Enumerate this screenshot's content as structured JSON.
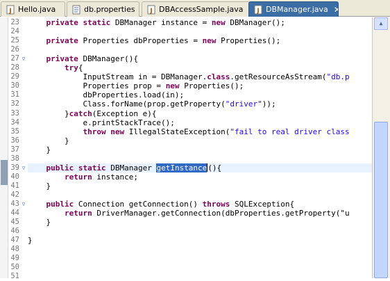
{
  "tabs": [
    {
      "label": "Hello.java",
      "icon": "java-file-icon",
      "active": false
    },
    {
      "label": "db.properties",
      "icon": "properties-file-icon",
      "active": false
    },
    {
      "label": "DBAccessSample.java",
      "icon": "java-file-icon",
      "active": false
    },
    {
      "label": "DBManager.java",
      "icon": "java-file-icon",
      "active": true
    }
  ],
  "close_glyph": "✕",
  "fold_glyph": "▽",
  "colors": {
    "keyword": "#7f0055",
    "string": "#2a00ff",
    "selection": "#316ac5",
    "active_tab": "#3a6ea5"
  },
  "code_lines": [
    {
      "num": "23",
      "fold": false,
      "segs": [
        [
          "kw",
          "    private static "
        ],
        [
          "p",
          "DBManager instance = "
        ],
        [
          "kw",
          "new "
        ],
        [
          "p",
          "DBManager();"
        ]
      ]
    },
    {
      "num": "24",
      "fold": false,
      "segs": []
    },
    {
      "num": "25",
      "fold": false,
      "segs": [
        [
          "kw",
          "    private "
        ],
        [
          "p",
          "Properties dbProperties = "
        ],
        [
          "kw",
          "new "
        ],
        [
          "p",
          "Properties();"
        ]
      ]
    },
    {
      "num": "26",
      "fold": false,
      "segs": []
    },
    {
      "num": "27",
      "fold": true,
      "segs": [
        [
          "kw",
          "    private "
        ],
        [
          "p",
          "DBManager(){"
        ]
      ]
    },
    {
      "num": "28",
      "fold": false,
      "segs": [
        [
          "kw",
          "        try"
        ],
        [
          "p",
          "{"
        ]
      ]
    },
    {
      "num": "29",
      "fold": false,
      "segs": [
        [
          "p",
          "            InputStream in = DBManager."
        ],
        [
          "kw",
          "class"
        ],
        [
          "p",
          ".getResourceAsStream("
        ],
        [
          "str",
          "\"db.p"
        ]
      ]
    },
    {
      "num": "30",
      "fold": false,
      "segs": [
        [
          "p",
          "            Properties prop = "
        ],
        [
          "kw",
          "new "
        ],
        [
          "p",
          "Properties();"
        ]
      ]
    },
    {
      "num": "31",
      "fold": false,
      "segs": [
        [
          "p",
          "            dbProperties.load(in);"
        ]
      ]
    },
    {
      "num": "32",
      "fold": false,
      "segs": [
        [
          "p",
          "            Class.forName(prop.getProperty("
        ],
        [
          "str",
          "\"driver\""
        ],
        [
          "p",
          "));"
        ]
      ]
    },
    {
      "num": "33",
      "fold": false,
      "segs": [
        [
          "p",
          "        }"
        ],
        [
          "kw",
          "catch"
        ],
        [
          "p",
          "(Exception e){"
        ]
      ]
    },
    {
      "num": "34",
      "fold": false,
      "segs": [
        [
          "p",
          "            e.printStackTrace();"
        ]
      ]
    },
    {
      "num": "35",
      "fold": false,
      "segs": [
        [
          "kw",
          "            throw new "
        ],
        [
          "p",
          "IllegalStateException("
        ],
        [
          "str",
          "\"fail to real driver class"
        ]
      ]
    },
    {
      "num": "36",
      "fold": false,
      "segs": [
        [
          "p",
          "        }"
        ]
      ]
    },
    {
      "num": "37",
      "fold": false,
      "segs": [
        [
          "p",
          "    }"
        ]
      ]
    },
    {
      "num": "38",
      "fold": false,
      "segs": []
    },
    {
      "num": "39",
      "fold": true,
      "segs": [
        [
          "kw",
          "    public static "
        ],
        [
          "p",
          "DBManager "
        ],
        [
          "hl",
          "getInstance"
        ],
        [
          "caret",
          ""
        ],
        [
          "p",
          "(){"
        ]
      ]
    },
    {
      "num": "40",
      "fold": false,
      "segs": [
        [
          "kw",
          "        return "
        ],
        [
          "p",
          "instance;"
        ]
      ]
    },
    {
      "num": "41",
      "fold": false,
      "segs": [
        [
          "p",
          "    }"
        ]
      ]
    },
    {
      "num": "42",
      "fold": false,
      "segs": []
    },
    {
      "num": "43",
      "fold": true,
      "segs": [
        [
          "kw",
          "    public "
        ],
        [
          "p",
          "Connection getConnection() "
        ],
        [
          "kw",
          "throws "
        ],
        [
          "p",
          "SQLException{"
        ]
      ]
    },
    {
      "num": "44",
      "fold": false,
      "segs": [
        [
          "kw",
          "        return "
        ],
        [
          "p",
          "DriverManager.getConnection(dbProperties.getProperty(\"u"
        ]
      ]
    },
    {
      "num": "45",
      "fold": false,
      "segs": [
        [
          "p",
          "    }"
        ]
      ]
    },
    {
      "num": "46",
      "fold": false,
      "segs": []
    },
    {
      "num": "47",
      "fold": false,
      "segs": [
        [
          "p",
          "}"
        ]
      ]
    },
    {
      "num": "48",
      "fold": false,
      "segs": []
    },
    {
      "num": "49",
      "fold": false,
      "segs": []
    },
    {
      "num": "50",
      "fold": false,
      "segs": []
    },
    {
      "num": "51",
      "fold": false,
      "segs": []
    }
  ],
  "current_line": "39",
  "scroll": {
    "thumb_fraction": 0.6,
    "thumb_position": 0.4
  }
}
